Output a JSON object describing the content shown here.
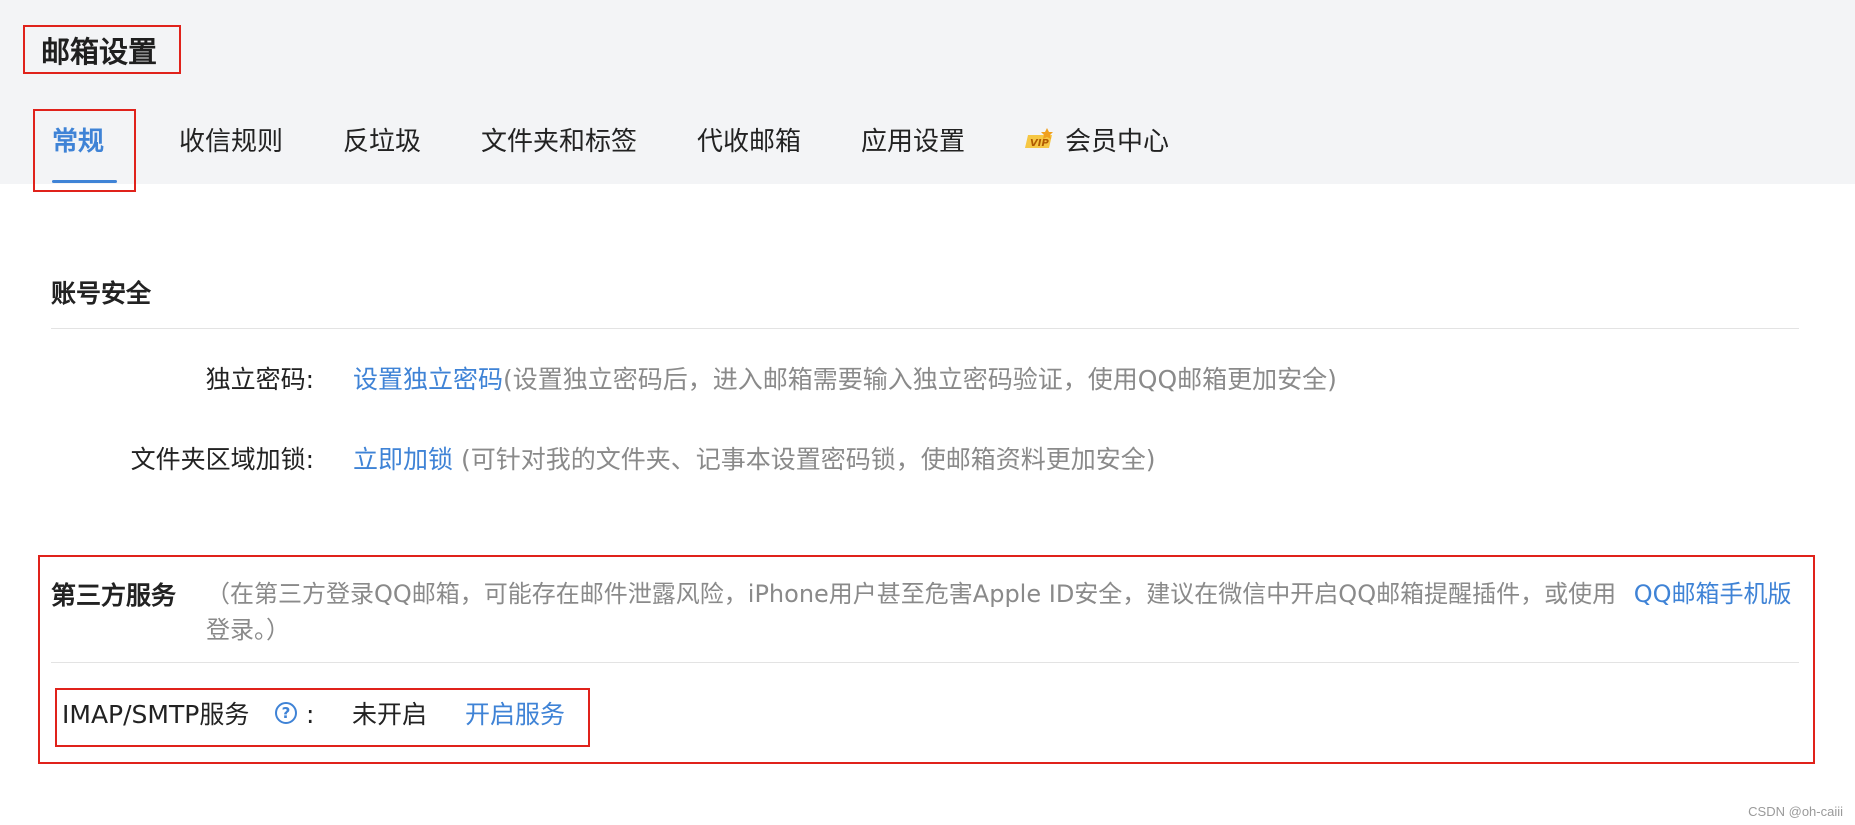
{
  "header": {
    "title": "邮箱设置",
    "tabs": [
      {
        "label": "常规",
        "active": true
      },
      {
        "label": "收信规则",
        "active": false
      },
      {
        "label": "反垃圾",
        "active": false
      },
      {
        "label": "文件夹和标签",
        "active": false
      },
      {
        "label": "代收邮箱",
        "active": false
      },
      {
        "label": "应用设置",
        "active": false
      },
      {
        "label": "会员中心",
        "active": false,
        "icon": "vip-icon"
      }
    ],
    "vip_badge_text": "VIP"
  },
  "account_security": {
    "title": "账号安全",
    "rows": [
      {
        "label": "独立密码:",
        "link": "设置独立密码",
        "desc": "(设置独立密码后，进入邮箱需要输入独立密码验证，使用QQ邮箱更加安全)"
      },
      {
        "label": "文件夹区域加锁:",
        "link": "立即加锁",
        "desc": " (可针对我的文件夹、记事本设置密码锁，使邮箱资料更加安全)"
      }
    ]
  },
  "third_party": {
    "title": "第三方服务",
    "desc": "（在第三方登录QQ邮箱，可能存在邮件泄露风险，iPhone用户甚至危害Apple ID安全，建议在微信中开启QQ邮箱提醒插件，或使用",
    "desc_link": "QQ邮箱手机版",
    "desc_tail": "登录。）",
    "imap": {
      "label": "IMAP/SMTP服务",
      "help_icon": "?",
      "colon": ":",
      "status": "未开启",
      "action": "开启服务"
    }
  },
  "watermark": "CSDN @oh-caiii",
  "colors": {
    "accent": "#3f83d6",
    "annotation": "#e0221b",
    "header_bg": "#f3f4f6"
  }
}
